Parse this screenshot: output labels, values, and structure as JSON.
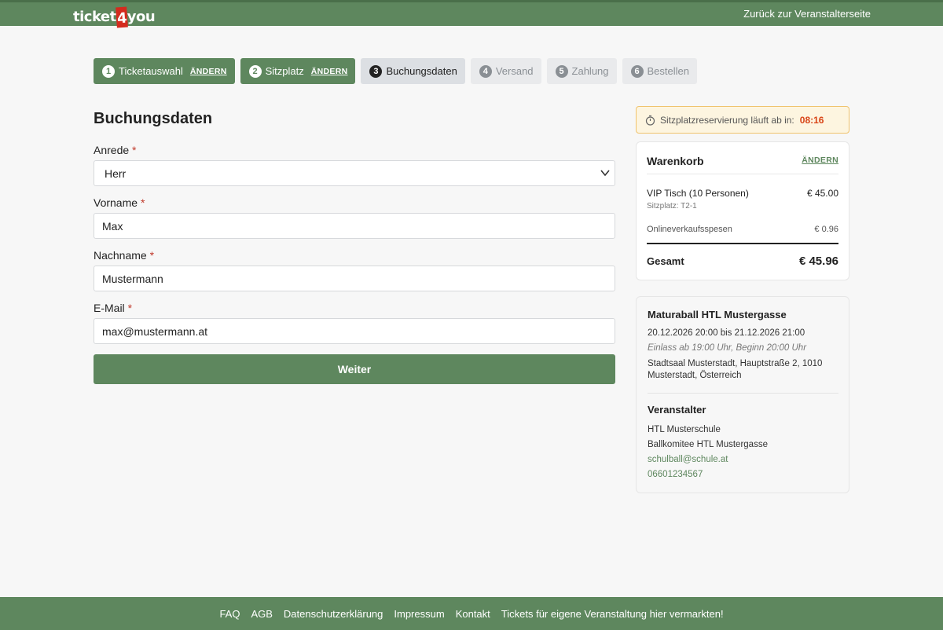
{
  "header": {
    "logo": {
      "part1": "ticket",
      "part2": "4",
      "part3": "you"
    },
    "back_link": "Zurück zur Veranstalterseite"
  },
  "steps": [
    {
      "num": "1",
      "label": "Ticketauswahl",
      "edit": "ÄNDERN",
      "state": "done"
    },
    {
      "num": "2",
      "label": "Sitzplatz",
      "edit": "ÄNDERN",
      "state": "done"
    },
    {
      "num": "3",
      "label": "Buchungsdaten",
      "state": "active"
    },
    {
      "num": "4",
      "label": "Versand",
      "state": "todo"
    },
    {
      "num": "5",
      "label": "Zahlung",
      "state": "todo"
    },
    {
      "num": "6",
      "label": "Bestellen",
      "state": "todo"
    }
  ],
  "form": {
    "title": "Buchungsdaten",
    "required_mark": "*",
    "salutation": {
      "label": "Anrede",
      "value": "Herr"
    },
    "firstname": {
      "label": "Vorname",
      "value": "Max"
    },
    "lastname": {
      "label": "Nachname",
      "value": "Mustermann"
    },
    "email": {
      "label": "E-Mail",
      "value": "max@mustermann.at"
    },
    "submit": "Weiter"
  },
  "timer": {
    "label": "Sitzplatzreservierung läuft ab in:",
    "time": "08:16"
  },
  "cart": {
    "title": "Warenkorb",
    "edit": "ÄNDERN",
    "item": {
      "name": "VIP Tisch (10 Personen)",
      "price": "€ 45.00",
      "seat": "Sitzplatz: T2-1"
    },
    "fee": {
      "label": "Onlineverkaufsspesen",
      "price": "€ 0.96"
    },
    "total": {
      "label": "Gesamt",
      "price": "€ 45.96"
    }
  },
  "event": {
    "title": "Maturaball HTL Mustergasse",
    "date": "20.12.2026 20:00 bis 21.12.2026 21:00",
    "admission": "Einlass ab 19:00 Uhr, Beginn 20:00 Uhr",
    "address": "Stadtsaal Musterstadt, Hauptstraße 2, 1010 Musterstadt, Österreich",
    "organizer_title": "Veranstalter",
    "organizer_name": "HTL Musterschule",
    "organizer_committee": "Ballkomitee HTL Mustergasse",
    "email": "schulball@schule.at",
    "phone": "06601234567"
  },
  "footer": {
    "links": [
      "FAQ",
      "AGB",
      "Datenschutzerklärung",
      "Impressum",
      "Kontakt",
      "Tickets für eigene Veranstaltung hier vermarkten!"
    ]
  },
  "colors": {
    "brand_green": "#5e875e",
    "logo_red": "#d42b1e",
    "timer_red": "#d84315",
    "required_red": "#c0392b"
  }
}
